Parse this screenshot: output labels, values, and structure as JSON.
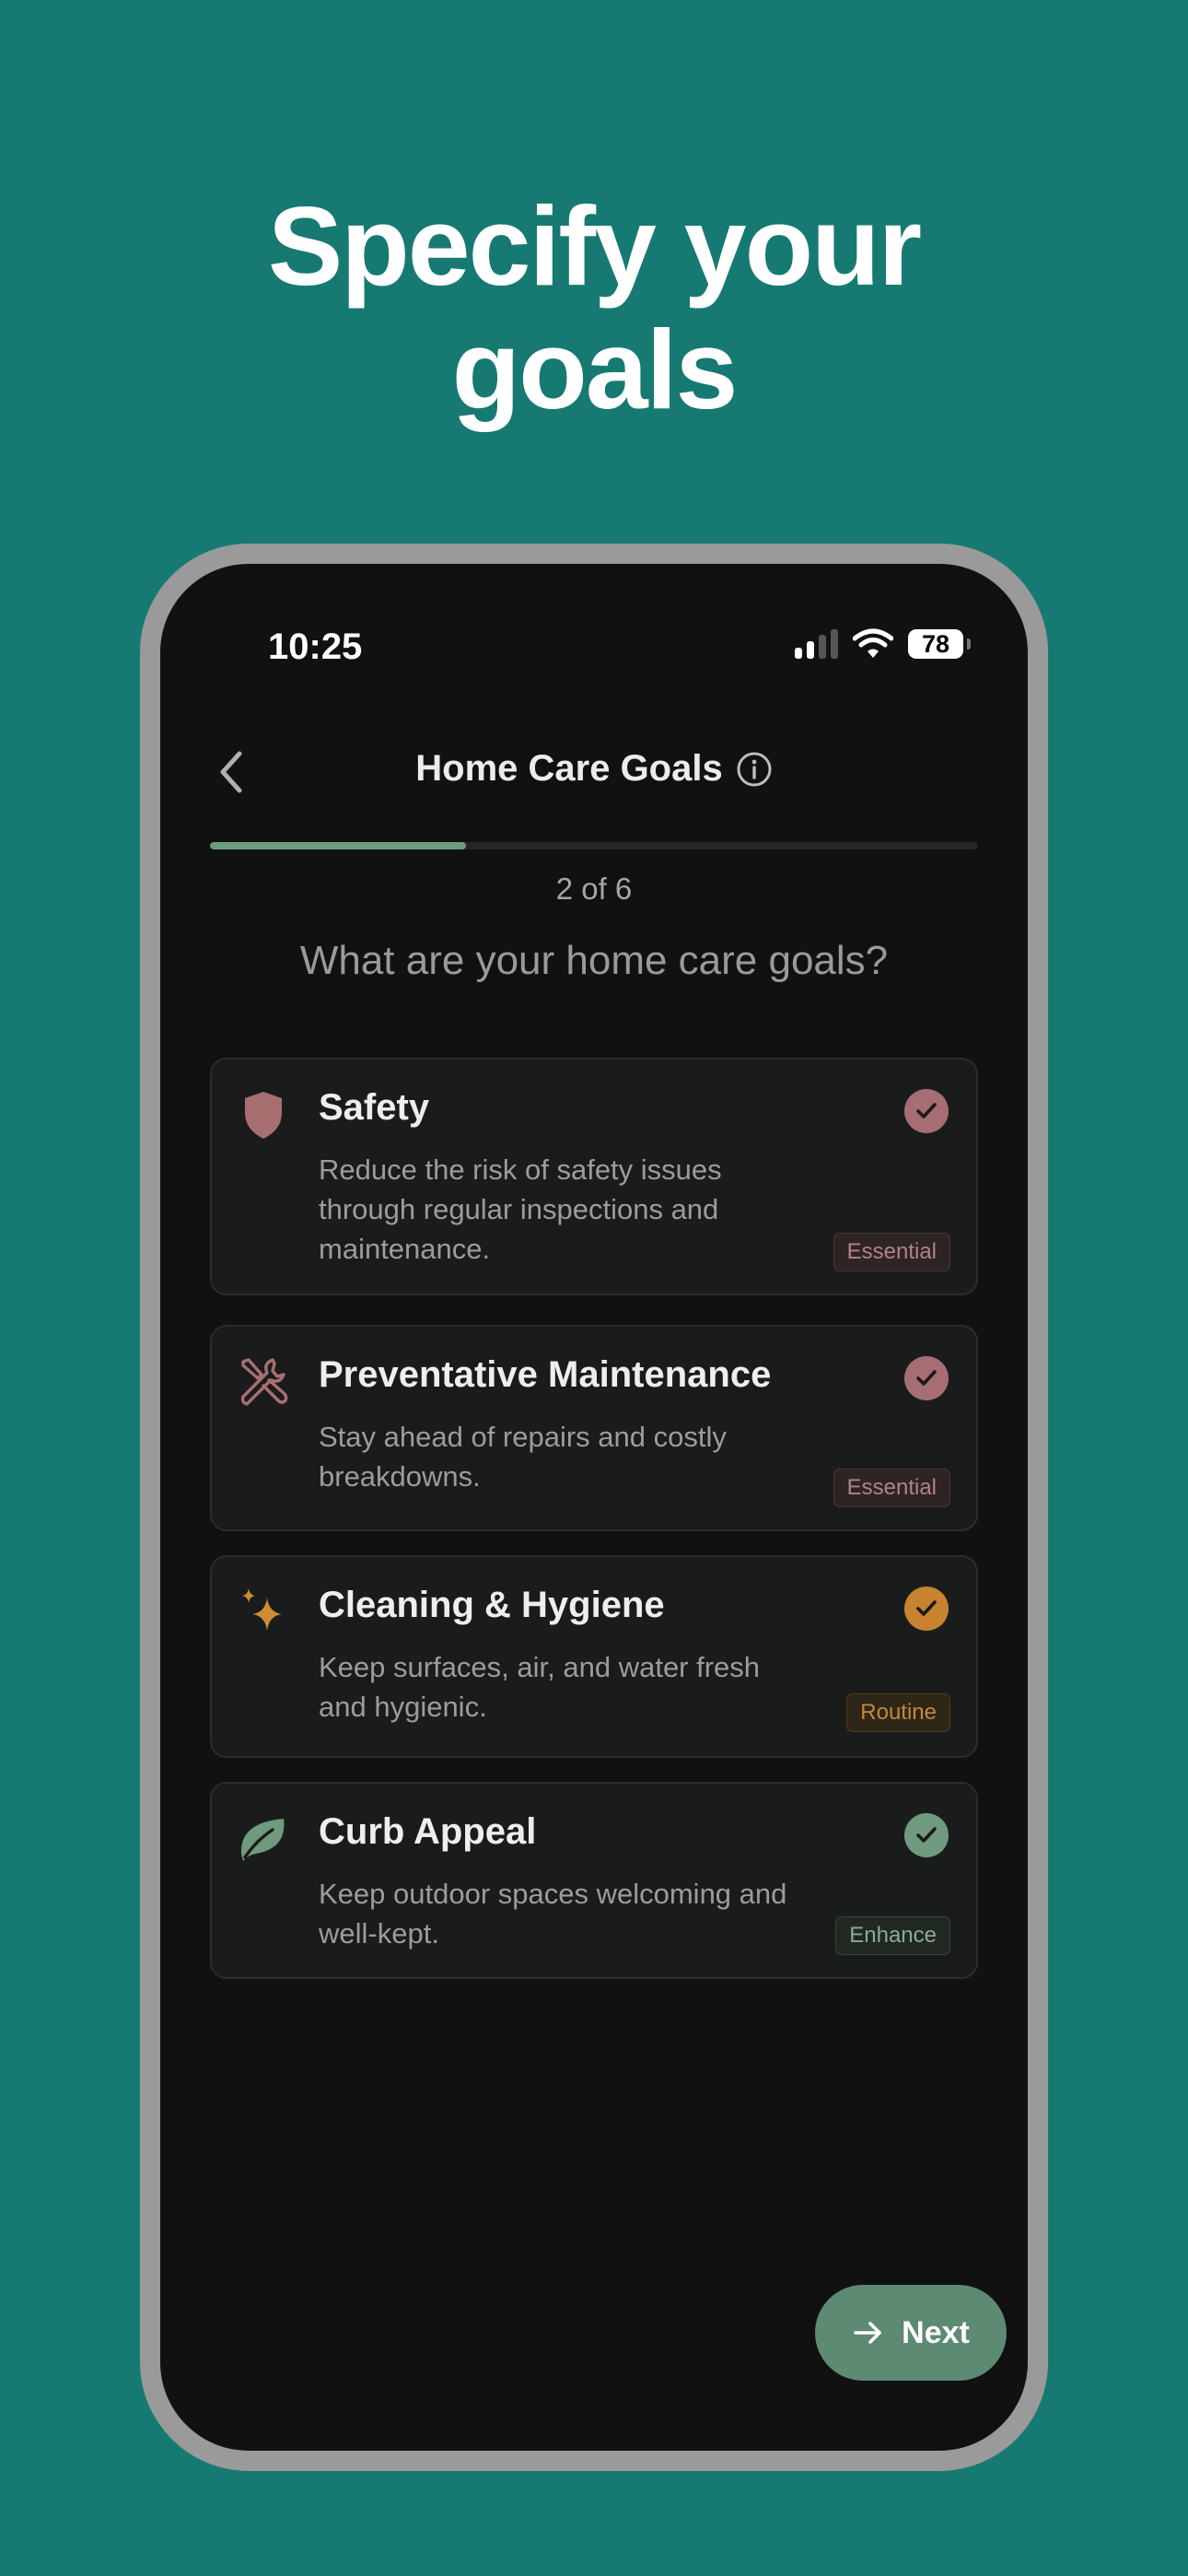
{
  "headline": {
    "line1": "Specify your",
    "line2": "goals"
  },
  "status_bar": {
    "time": "10:25",
    "battery": "78"
  },
  "header": {
    "title": "Home Care Goals"
  },
  "progress": {
    "fraction": 0.333,
    "label": "2 of 6"
  },
  "question": "What are your home care goals?",
  "goals": [
    {
      "title": "Safety",
      "description": "Reduce the risk of safety issues through regular inspections and maintenance.",
      "tag": "Essential",
      "icon": "shield-icon",
      "checked": true,
      "accent": "#b07a7a"
    },
    {
      "title": "Preventative Maintenance",
      "description": "Stay ahead of repairs and costly breakdowns.",
      "tag": "Essential",
      "icon": "tools-icon",
      "checked": true,
      "accent": "#b07a7a"
    },
    {
      "title": "Cleaning & Hygiene",
      "description": "Keep surfaces, air, and water fresh and hygienic.",
      "tag": "Routine",
      "icon": "sparkle-icon",
      "checked": true,
      "accent": "#cf8c33"
    },
    {
      "title": "Curb Appeal",
      "description": "Keep outdoor spaces welcoming and well-kept.",
      "tag": "Enhance",
      "icon": "leaf-icon",
      "checked": true,
      "accent": "#6f9a7e"
    }
  ],
  "next_button": {
    "label": "Next"
  }
}
